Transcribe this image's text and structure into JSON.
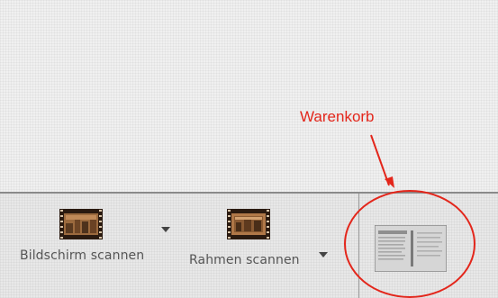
{
  "toolbar": {
    "screen_scan": {
      "label": "Bildschirm scannen",
      "icon": "film-strip-icon"
    },
    "frame_scan": {
      "label": "Rahmen scannen",
      "icon": "film-strip-icon"
    }
  },
  "cart": {
    "icon": "document-thumbnail"
  },
  "annotation": {
    "text": "Warenkorb",
    "color": "#e3261b"
  },
  "colors": {
    "annotation": "#e3261b",
    "label": "#555555",
    "divider": "#8a8a8a"
  }
}
